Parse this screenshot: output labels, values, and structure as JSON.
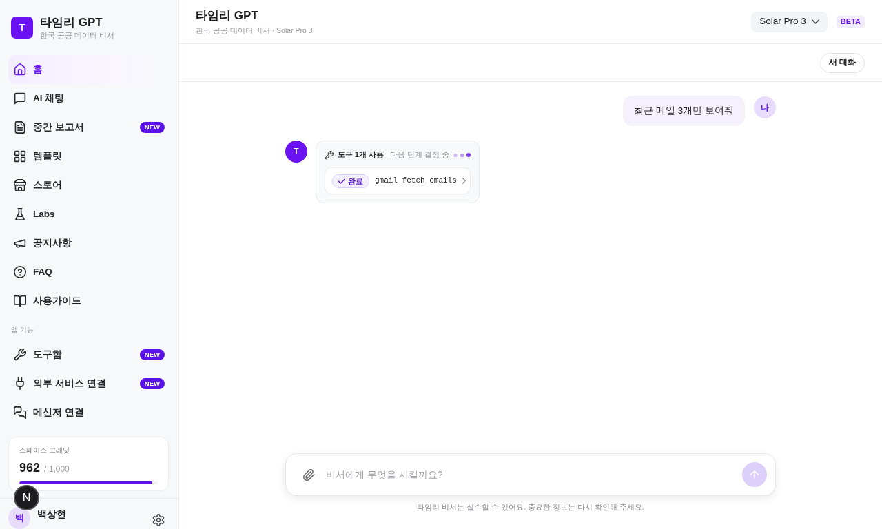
{
  "sidebar": {
    "brand": {
      "logo": "T",
      "title": "타임리 GPT",
      "subtitle": "한국 공공 데이터 비서"
    },
    "nav": [
      {
        "label": "홈",
        "selected": true
      },
      {
        "label": "AI 채팅",
        "selected": false
      },
      {
        "label": "중간 보고서",
        "selected": false,
        "badge": "NEW"
      },
      {
        "label": "템플릿",
        "selected": false
      },
      {
        "label": "스토어",
        "selected": false
      },
      {
        "label": "Labs",
        "selected": false
      },
      {
        "label": "공지사항",
        "selected": false
      },
      {
        "label": "FAQ",
        "selected": false
      },
      {
        "label": "사용가이드",
        "selected": false
      }
    ],
    "sections": [
      {
        "title": "앱 기능",
        "items": [
          {
            "label": "도구함",
            "selected": false,
            "badge": "NEW"
          },
          {
            "label": "외부 서비스 연결",
            "selected": false,
            "badge": "NEW"
          },
          {
            "label": "메신저 연결",
            "selected": false
          }
        ]
      }
    ],
    "credits": {
      "title": "스페이스 크레딧",
      "value": "962",
      "total": "/ 1,000",
      "level": 0.962
    },
    "user": {
      "avatar": "백",
      "name": "백상현"
    }
  },
  "header": {
    "title": "타임리 GPT",
    "subtitle": "한국 공공 데이터 비서 · Solar Pro 3",
    "model": "Solar Pro 3",
    "badge": "BETA"
  },
  "toolbar": {
    "new_chat": "새 대화"
  },
  "messages": [
    {
      "kind": "user",
      "avatar": "나",
      "text": "최근 메일 3개만 보여줘"
    },
    {
      "kind": "tool_use",
      "avatar": "T",
      "title": "도구 1개 사용",
      "status_text": "다음 단계 결정 중",
      "tools": [
        {
          "done": true,
          "status": "완료",
          "name": "gmail_fetch_emails"
        }
      ]
    }
  ],
  "composer": {
    "placeholder": "비서에게 무엇을 시킬까요?",
    "send": {
      "disabled": true
    }
  },
  "disclaimer": "타임리 비서는 실수할 수 있어요. 중요한 정보는 다시 확인해 주세요.",
  "dev_indicator": {
    "label": "N"
  }
}
